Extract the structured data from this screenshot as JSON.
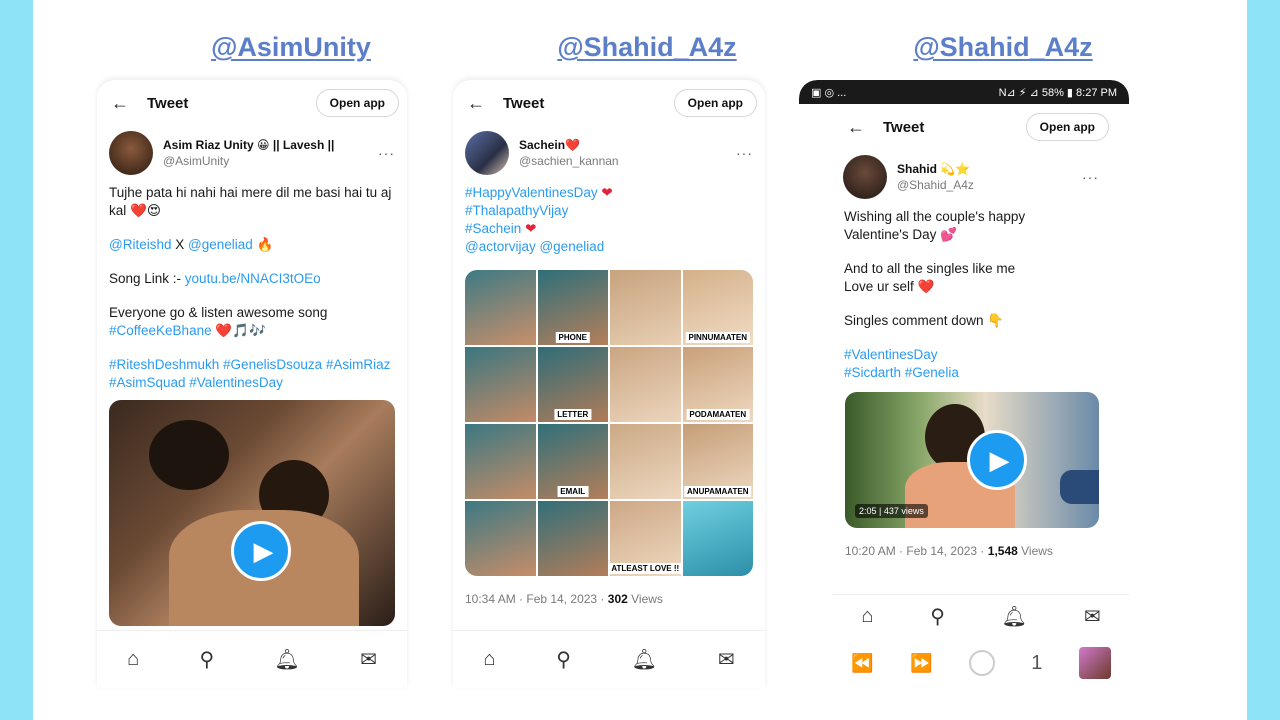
{
  "handles": [
    "@AsimUnity",
    "@Shahid_A4z",
    "@Shahid_A4z"
  ],
  "common": {
    "tweet_title": "Tweet",
    "open_app": "Open app",
    "back_glyph": "←",
    "more_glyph": "···",
    "nav_icons": [
      "home-icon",
      "search-icon",
      "bell-icon",
      "mail-icon"
    ]
  },
  "tweet1": {
    "display_name": "Asim Riaz Unity 😀 || Lavesh ||",
    "username": "@AsimUnity",
    "text1": "Tujhe pata hi nahi hai mere dil me basi hai tu aj kal",
    "text1_emoji": "❤️😍",
    "mention_a": "@Riteishd",
    "mention_x": " X ",
    "mention_b": "@geneliad",
    "mention_emoji": "🔥",
    "song_label": "Song Link :- ",
    "song_link": "youtu.be/NNACI3tOEo",
    "text3": "Everyone go & listen awesome song",
    "hashtag1": "#CoffeeKeBhane",
    "text3_emoji": "❤️🎵🎶",
    "hashtags2": "#RiteshDeshmukh #GenelisDsouza #AsimRiaz #AsimSquad #ValentinesDay"
  },
  "tweet2": {
    "display_name": "Sachein❤️",
    "username": "@sachien_kannan",
    "tag1": "#HappyValentinesDay",
    "tag2": "#ThalapathyVijay",
    "tag3": "#Sachein",
    "mentions": "@actorvijay @geneliad",
    "captions": [
      "PHONE",
      "PINNUMAATEN",
      "LETTER",
      "PODAMAATEN",
      "EMAIL",
      "ANUPAMAATEN",
      "ATLEAST LOVE !!"
    ],
    "time": "10:34 AM · Feb 14, 2023 · ",
    "views": "302",
    "views_label": " Views"
  },
  "tweet3": {
    "status_left": "▣ ◎ ...",
    "status_right": "N⊿ ⚡ ⊿ 58% ▮ 8:27 PM",
    "display_name": "Shahid 💫⭐",
    "username": "@Shahid_A4z",
    "text1": "Wishing all the couple's happy Valentine's Day 💕",
    "text2a": "And to all the singles like me",
    "text2b": "Love ur self ❤️",
    "text3": "Singles comment down 👇",
    "tag1": "#ValentinesDay",
    "tag2": "#Sicdarth #Genelia",
    "video_badge": "2:05 | 437 views",
    "time": "10:20 AM · Feb 14, 2023 · ",
    "views": "1,548",
    "views_label": " Views",
    "browser_num": "1"
  }
}
